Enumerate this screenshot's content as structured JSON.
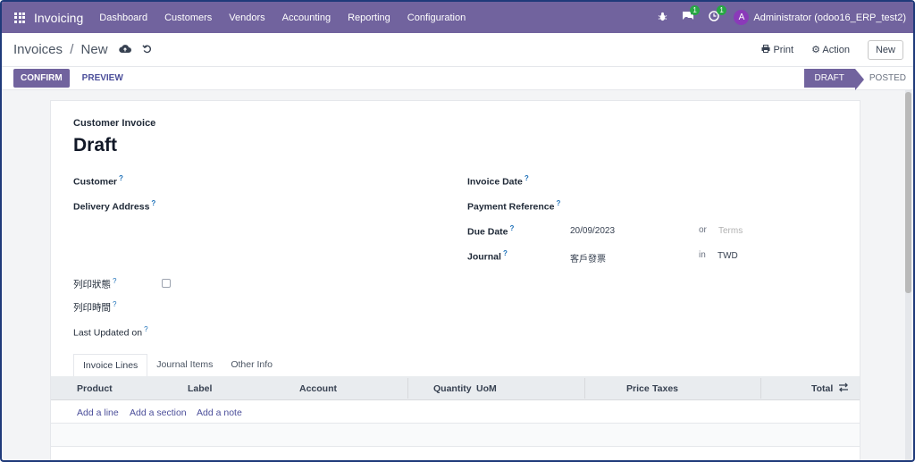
{
  "navbar": {
    "brand": "Invoicing",
    "menu": [
      "Dashboard",
      "Customers",
      "Vendors",
      "Accounting",
      "Reporting",
      "Configuration"
    ],
    "messages_count": "1",
    "activities_count": "1",
    "user_initial": "A",
    "user_name": "Administrator (odoo16_ERP_test2)"
  },
  "control": {
    "breadcrumb_parent": "Invoices",
    "breadcrumb_sep": "/",
    "breadcrumb_current": "New",
    "print_label": "Print",
    "action_label": "Action",
    "new_label": "New"
  },
  "statusbar": {
    "confirm_label": "CONFIRM",
    "preview_label": "PREVIEW",
    "stages": [
      "DRAFT",
      "POSTED"
    ]
  },
  "form": {
    "move_type": "Customer Invoice",
    "title": "Draft",
    "customer_label": "Customer",
    "delivery_address_label": "Delivery Address",
    "invoice_date_label": "Invoice Date",
    "payment_reference_label": "Payment Reference",
    "due_date_label": "Due Date",
    "due_date_value": "20/09/2023",
    "or_label": "or",
    "terms_placeholder": "Terms",
    "journal_label": "Journal",
    "journal_value": "客戶發票",
    "in_label": "in",
    "currency_value": "TWD",
    "print_status_label": "列印狀態",
    "print_time_label": "列印時間",
    "last_updated_label": "Last Updated on",
    "help_mark": "?"
  },
  "tabs": [
    "Invoice Lines",
    "Journal Items",
    "Other Info"
  ],
  "lines_table": {
    "columns": [
      "Product",
      "Label",
      "Account",
      "Quantity",
      "UoM",
      "Price",
      "Taxes",
      "Total"
    ],
    "add_line": "Add a line",
    "add_section": "Add a section",
    "add_note": "Add a note"
  },
  "colors": {
    "brand": "#71639e",
    "link": "#4b4e9a",
    "help": "#1d70b8",
    "badge": "#28a745"
  }
}
